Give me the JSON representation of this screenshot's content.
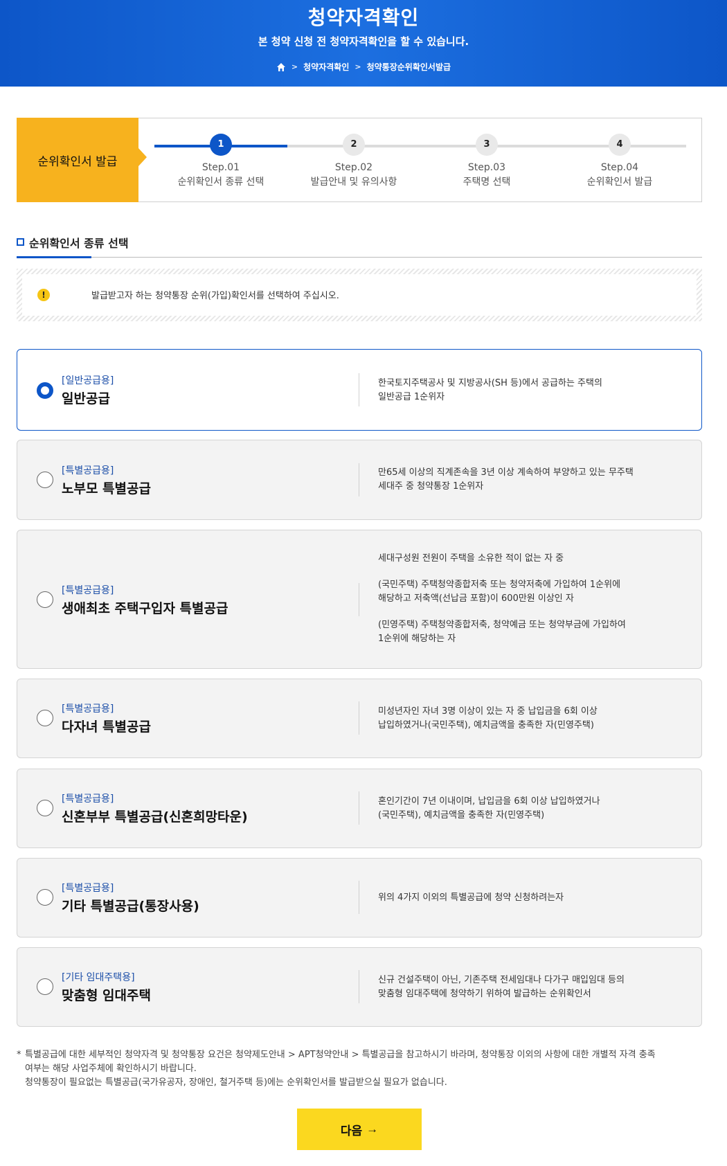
{
  "hero": {
    "title": "청약자격확인",
    "subtitle": "본 청약 신청 전 청약자격확인을 할 수 있습니다.",
    "breadcrumb": [
      "청약자격확인",
      "청약통장순위확인서발급"
    ]
  },
  "steps": {
    "label": "순위확인서 발급",
    "current": 1,
    "items": [
      {
        "num": "1",
        "step": "Step.01",
        "desc": "순위확인서 종류 선택"
      },
      {
        "num": "2",
        "step": "Step.02",
        "desc": "발급안내 및 유의사항"
      },
      {
        "num": "3",
        "step": "Step.03",
        "desc": "주택명 선택"
      },
      {
        "num": "4",
        "step": "Step.04",
        "desc": "순위확인서 발급"
      }
    ]
  },
  "section": {
    "title": "순위확인서 종류 선택"
  },
  "notice": {
    "icon": "warning-icon",
    "text": "발급받고자 하는 청약통장 순위(가입)확인서를 선택하여 주십시오."
  },
  "options": [
    {
      "category": "[일반공급용]",
      "name": "일반공급",
      "selected": true,
      "desc": [
        "한국토지주택공사 및 지방공사(SH 등)에서 공급하는 주택의",
        "일반공급 1순위자"
      ]
    },
    {
      "category": "[특별공급용]",
      "name": "노부모 특별공급",
      "selected": false,
      "desc": [
        "만65세 이상의 직계존속을 3년 이상 계속하여 부양하고 있는 무주택",
        "세대주 중 청약통장 1순위자"
      ]
    },
    {
      "category": "[특별공급용]",
      "name": "생애최초 주택구입자 특별공급",
      "selected": false,
      "desc": [
        "세대구성원 전원이 주택을 소유한 적이 없는 자 중",
        "(국민주택) 주택청약종합저축 또는 청약저축에 가입하여 1순위에",
        "해당하고 저축액(선납금 포함)이 600만원 이상인 자",
        "(민영주택) 주택청약종합저축, 청약예금 또는 청약부금에 가입하여",
        "1순위에 해당하는 자"
      ]
    },
    {
      "category": "[특별공급용]",
      "name": "다자녀 특별공급",
      "selected": false,
      "desc": [
        "미성년자인 자녀 3명 이상이 있는 자 중 납입금을 6회 이상",
        "납입하였거나(국민주택), 예치금액을 충족한 자(민영주택)"
      ]
    },
    {
      "category": "[특별공급용]",
      "name": "신혼부부 특별공급(신혼희망타운)",
      "selected": false,
      "desc": [
        "혼인기간이 7년 이내이며, 납입금을 6회 이상 납입하였거나",
        "(국민주택), 예치금액을 충족한 자(민영주택)"
      ]
    },
    {
      "category": "[특별공급용]",
      "name": "기타 특별공급(통장사용)",
      "selected": false,
      "desc": [
        "위의 4가지 이외의 특별공급에 청약 신청하려는자"
      ]
    },
    {
      "category": "[기타 임대주택용]",
      "name": "맞춤형 임대주택",
      "selected": false,
      "desc": [
        "신규 건설주택이 아닌, 기존주택 전세임대나 다가구 매입임대 등의",
        "맞춤형 임대주택에 청약하기 위하여 발급하는 순위확인서"
      ]
    }
  ],
  "footnote": {
    "star": "*",
    "line1": "특별공급에 대한 세부적인 청약자격 및 청약통장 요건은 청약제도안내 > APT청약안내 > 특별공급을 참고하시기 바라며, 청약통장 이외의 사항에 대한 개별적 자격 충족",
    "line2": "여부는 해당 사업주체에 확인하시기 바랍니다.",
    "line3": "청약통장이 필요없는 특별공급(국가유공자, 장애인, 철거주택 등)에는 순위확인서를 발급받으실 필요가 없습니다."
  },
  "next_button": {
    "label": "다음",
    "arrow": "→"
  }
}
